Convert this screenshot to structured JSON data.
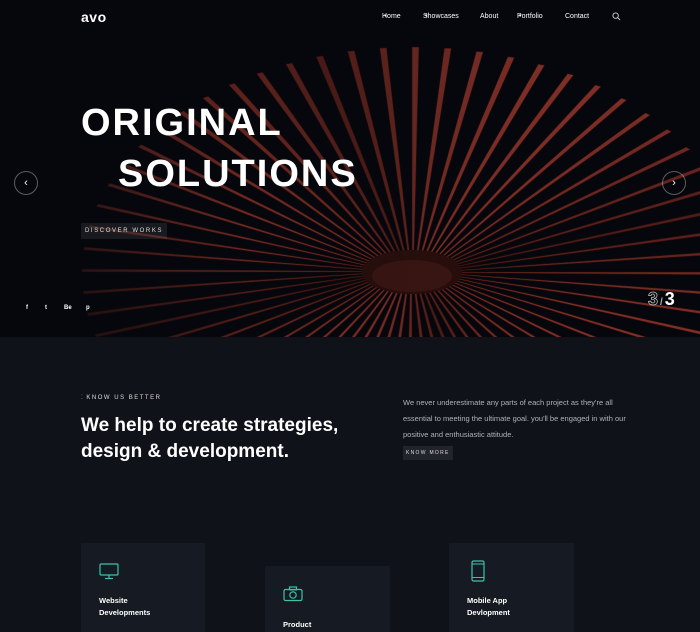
{
  "nav": {
    "logo": "avo",
    "items": [
      {
        "label": "Home",
        "has_dropdown": true
      },
      {
        "label": "Showcases",
        "has_dropdown": true
      },
      {
        "label": "About",
        "has_dropdown": false
      },
      {
        "label": "Portfolio",
        "has_dropdown": true
      },
      {
        "label": "Contact",
        "has_dropdown": false
      }
    ],
    "dropdown_caret": "▾",
    "search_icon": "search-icon"
  },
  "hero": {
    "title_line1": "ORIGINAL",
    "title_line2": "SOLUTIONS",
    "cta_label": "DISCOVER WORKS",
    "prev_arrow": "‹",
    "next_arrow": "›",
    "social": [
      "f",
      "t",
      "Be",
      "p"
    ],
    "slide_current": "3",
    "slide_separator": "/",
    "slide_total": "3"
  },
  "about": {
    "tagline_mark": "⁚",
    "tagline": "KNOW US BETTER",
    "headline_line1": "We help to create strategies,",
    "headline_line2": "design & development.",
    "text": "We never underestimate any parts of each project as they're all essential to meeting the ultimate goal. you'll be engaged in with our positive and enthusiastic attitude.",
    "cta_label": "KNOW MORE"
  },
  "services": [
    {
      "line1": "Website",
      "line2": "Developments",
      "icon": "monitor-icon"
    },
    {
      "line1": "Product",
      "line2": "",
      "icon": "camera-icon"
    },
    {
      "line1": "Mobile App",
      "line2": "Devlopment",
      "icon": "phone-icon"
    }
  ],
  "colors": {
    "accent": "#3ec1a8",
    "background": "#0f1218",
    "hero_object": "#6e2a22"
  }
}
